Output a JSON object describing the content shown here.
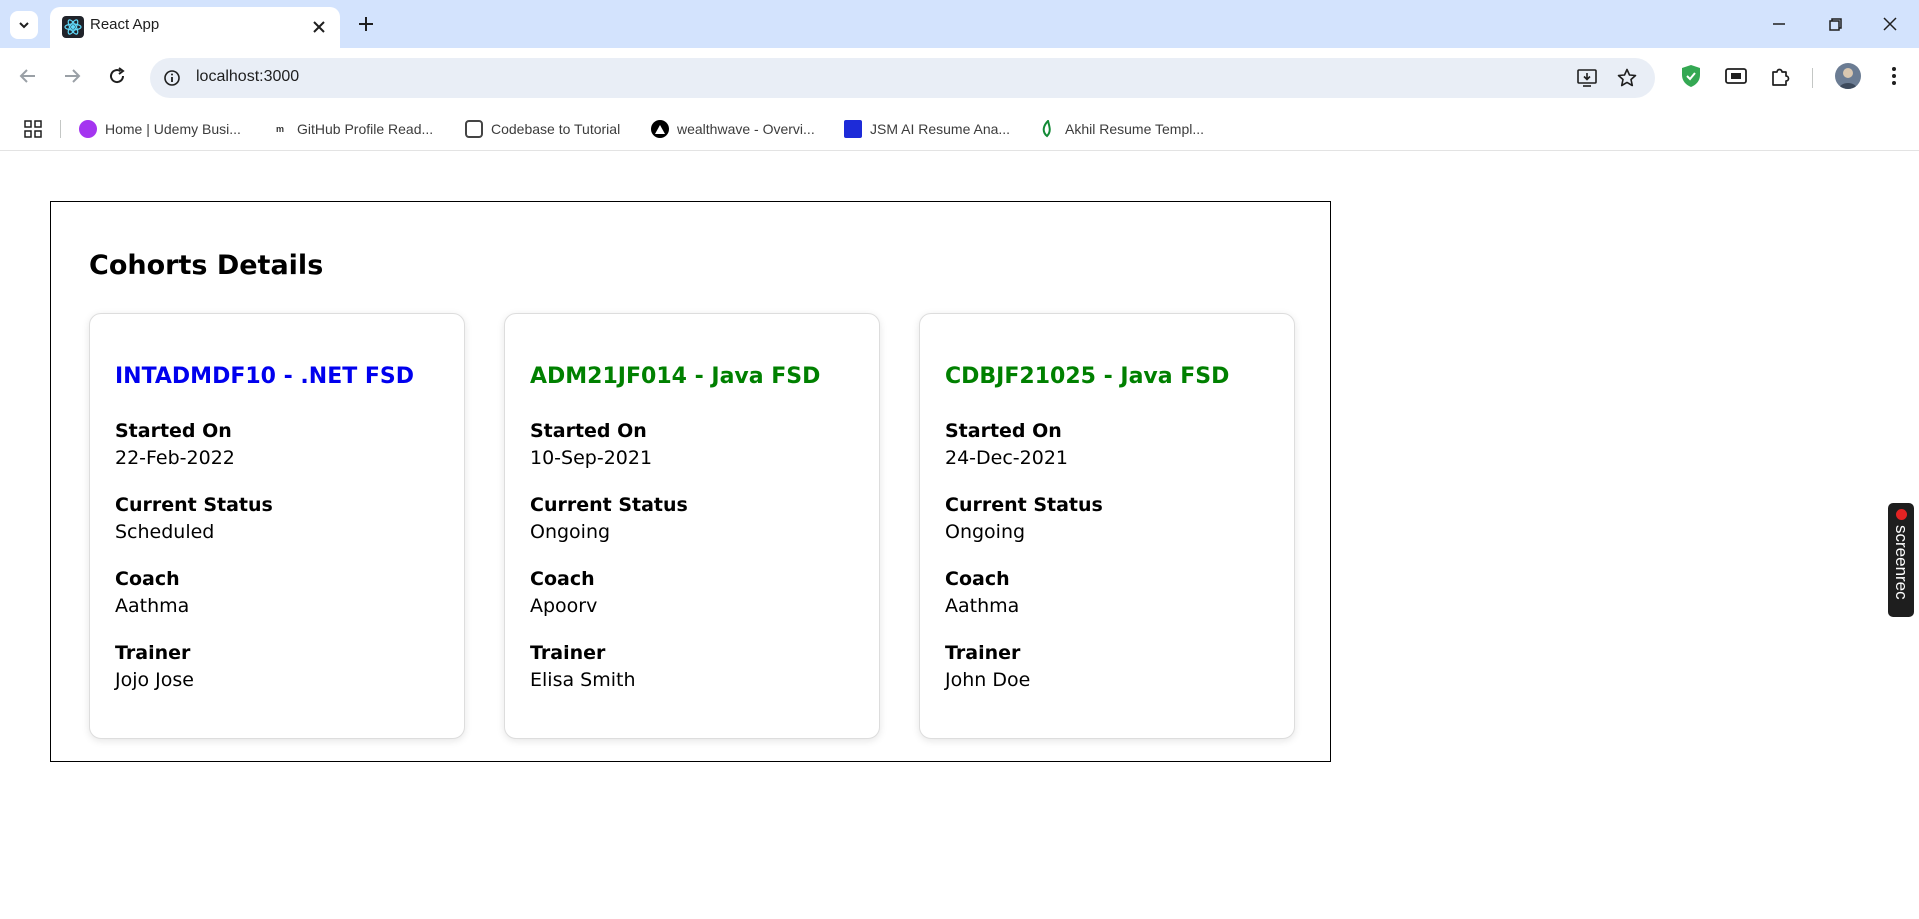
{
  "browser": {
    "tab_title": "React App",
    "url": "localhost:3000",
    "bookmarks": [
      {
        "label": "Home | Udemy Busi...",
        "icon": "udemy-icon",
        "color": "#a435f0"
      },
      {
        "label": "GitHub Profile Read...",
        "icon": "mg-icon",
        "color": "#333333"
      },
      {
        "label": "Codebase to Tutorial",
        "icon": "robot-icon",
        "color": "#444444"
      },
      {
        "label": "wealthwave - Overvi...",
        "icon": "vercel-triangle-icon",
        "color": "#000000"
      },
      {
        "label": "JSM AI Resume Ana...",
        "icon": "jsm-icon",
        "color": "#1d2bd8"
      },
      {
        "label": "Akhil Resume Templ...",
        "icon": "overleaf-icon",
        "color": "#138a36"
      }
    ]
  },
  "page": {
    "title": "Cohorts Details",
    "cohorts": [
      {
        "title": "INTADMDF10 - .NET FSD",
        "title_color": "#0000ee",
        "started_on_label": "Started On",
        "started_on": "22-Feb-2022",
        "status_label": "Current Status",
        "status": "Scheduled",
        "coach_label": "Coach",
        "coach": "Aathma",
        "trainer_label": "Trainer",
        "trainer": "Jojo Jose"
      },
      {
        "title": "ADM21JF014 - Java FSD",
        "title_color": "#008000",
        "started_on_label": "Started On",
        "started_on": "10-Sep-2021",
        "status_label": "Current Status",
        "status": "Ongoing",
        "coach_label": "Coach",
        "coach": "Apoorv",
        "trainer_label": "Trainer",
        "trainer": "Elisa Smith"
      },
      {
        "title": "CDBJF21025 - Java FSD",
        "title_color": "#008000",
        "started_on_label": "Started On",
        "started_on": "24-Dec-2021",
        "status_label": "Current Status",
        "status": "Ongoing",
        "coach_label": "Coach",
        "coach": "Aathma",
        "trainer_label": "Trainer",
        "trainer": "John Doe"
      }
    ]
  },
  "overlay": {
    "screenrec_label": "screenrec"
  }
}
